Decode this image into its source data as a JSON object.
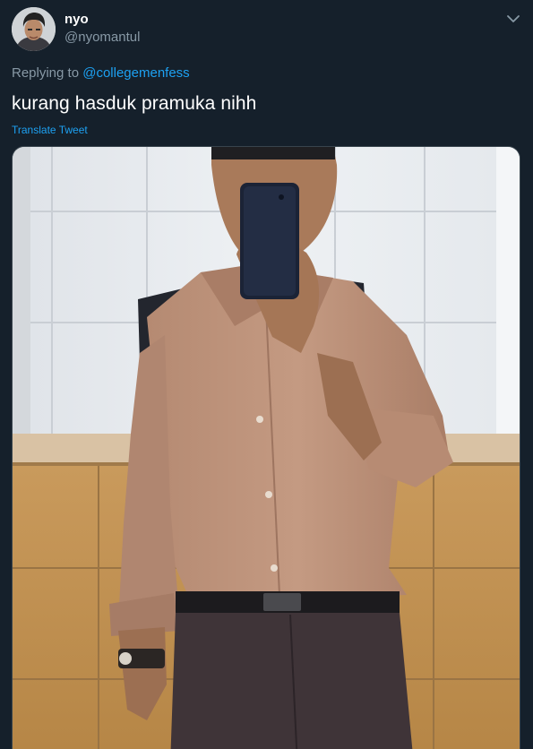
{
  "user": {
    "display_name": "nyo",
    "handle": "@nyomantul",
    "avatar_icon": "avatar-photo"
  },
  "menu_icon": "chevron-down-icon",
  "reply": {
    "prefix": "Replying to ",
    "mention": "@collegemenfess"
  },
  "tweet": {
    "text": "kurang hasduk pramuka nihh",
    "translate_label": "Translate Tweet"
  },
  "media": {
    "type": "photo",
    "subject": "mirror-selfie"
  },
  "colors": {
    "background": "#15202b",
    "link": "#1da1f2",
    "secondary_text": "#8899a6",
    "primary_text": "#ffffff"
  }
}
